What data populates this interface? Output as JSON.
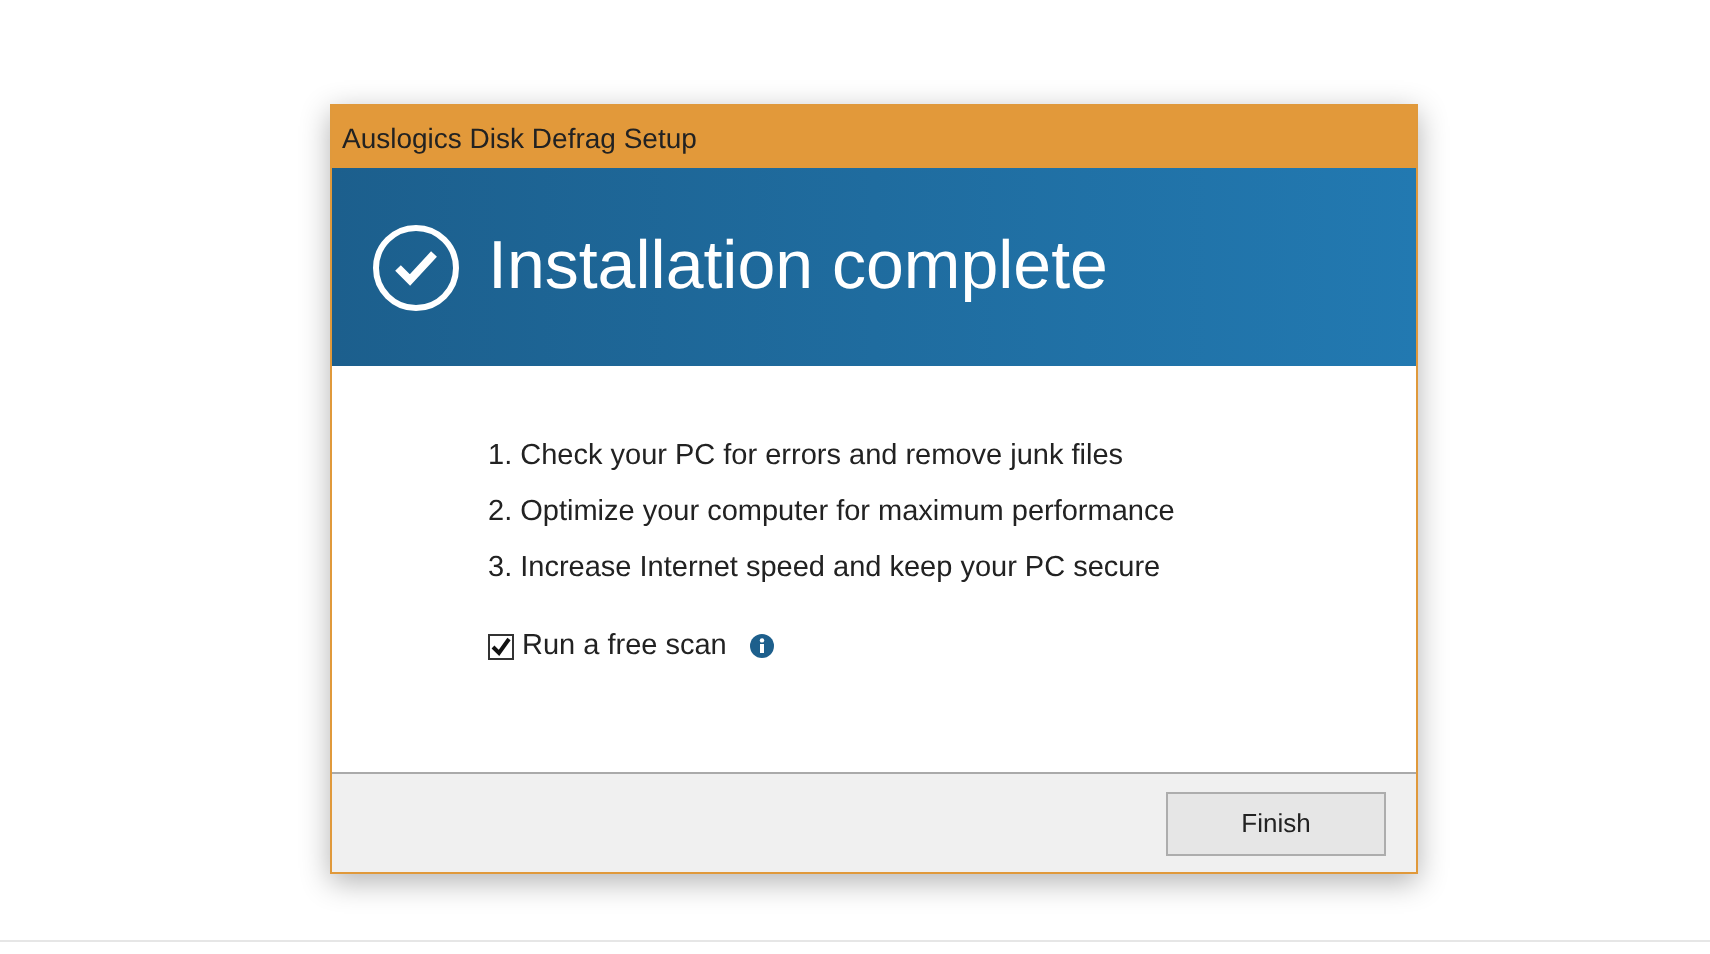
{
  "window": {
    "title": "Auslogics Disk Defrag Setup"
  },
  "banner": {
    "heading": "Installation complete"
  },
  "steps": [
    "1. Check your PC for errors and remove junk files",
    "2. Optimize your computer for maximum performance",
    "3. Increase Internet speed and keep your PC secure"
  ],
  "option": {
    "label": "Run a free scan",
    "checked": true
  },
  "buttons": [
    "Finish"
  ]
}
